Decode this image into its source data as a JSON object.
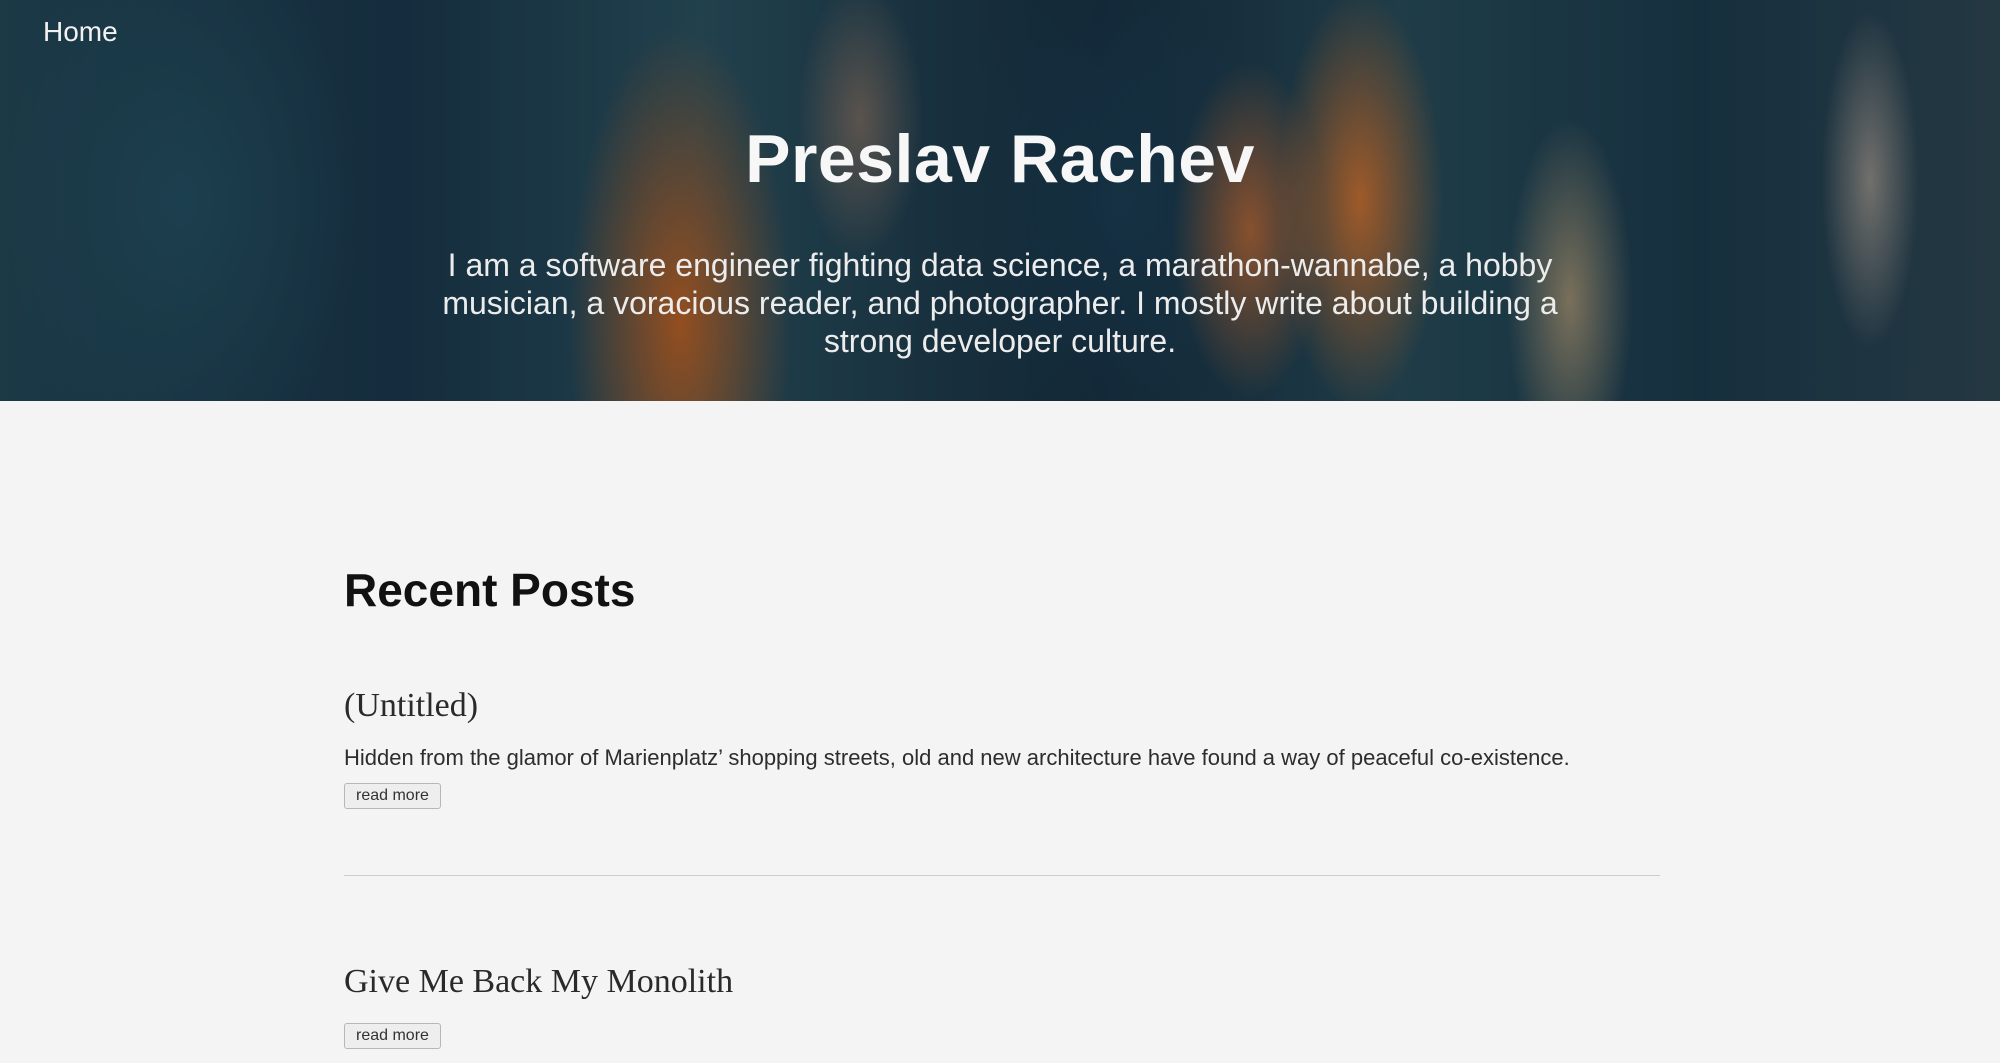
{
  "nav": {
    "home_label": "Home"
  },
  "hero": {
    "title": "Preslav Rachev",
    "tagline": "I am a software engineer fighting data science, a marathon-wannabe, a hobby musician, a voracious reader, and photographer. I mostly write about building a strong developer culture."
  },
  "main": {
    "section_title": "Recent Posts",
    "posts": [
      {
        "title": "(Untitled)",
        "excerpt": "Hidden from the glamor of Marienplatz’ shopping streets, old and new architecture have found a way of peaceful co-existence.",
        "read_more_label": "read more"
      },
      {
        "title": "Give Me Back My Monolith",
        "excerpt": "",
        "read_more_label": "read more"
      }
    ]
  }
}
